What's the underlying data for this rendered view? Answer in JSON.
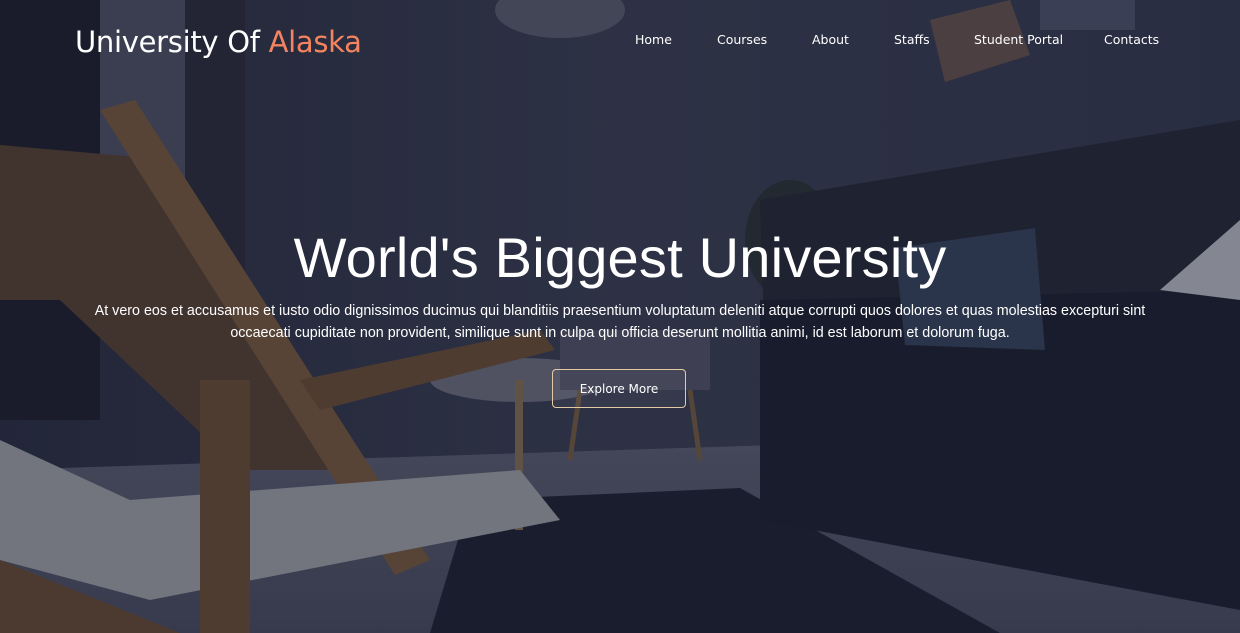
{
  "brand": {
    "name": "University Of",
    "accent": "Alaska"
  },
  "nav": {
    "home": "Home",
    "courses": "Courses",
    "about": "About",
    "staffs": "Staffs",
    "student_portal": "Student Portal",
    "contacts": "Contacts"
  },
  "hero": {
    "title": "World's Biggest University",
    "description": "At vero eos et accusamus et iusto odio dignissimos ducimus qui blanditiis praesentium voluptatum deleniti atque corrupti quos dolores et quas molestias excepturi sint occaecati cupiditate non provident, similique sunt in culpa qui officia deserunt mollitia animi, id est laborum et dolorum fuga.",
    "cta_label": "Explore More"
  },
  "colors": {
    "accent": "#f4845f",
    "button_border": "#e4c9a4"
  }
}
